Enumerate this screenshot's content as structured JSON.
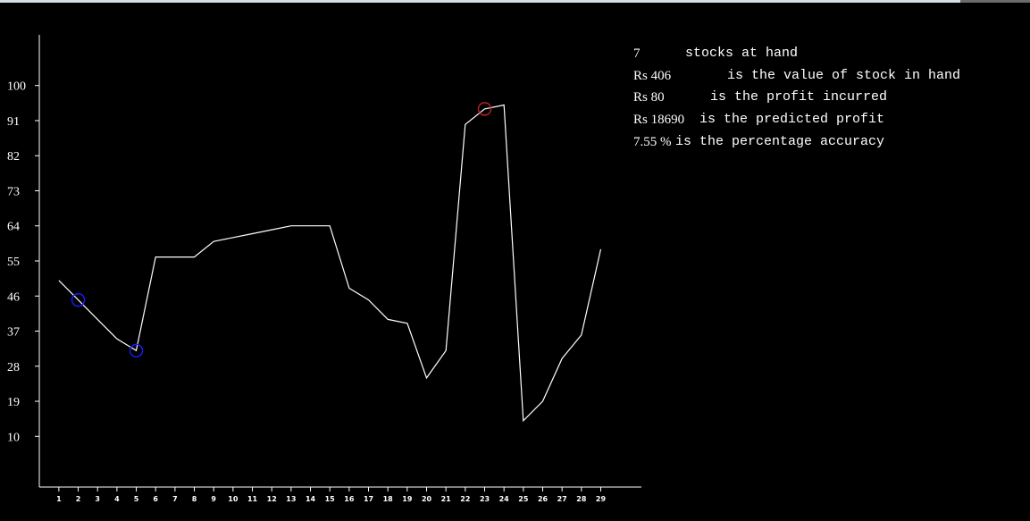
{
  "colors": {
    "background": "#000000",
    "line": "#ffffff",
    "axis": "#ffffff",
    "buy_marker": "#1a1aff",
    "sell_marker": "#c0202a"
  },
  "info": {
    "stocks_value": "7",
    "stocks_text": "stocks at hand",
    "stock_value": "Rs 406",
    "stock_text": "is the value of stock in hand",
    "profit_value": "Rs 80",
    "profit_text": "is the profit incurred",
    "predicted_value": "Rs 18690",
    "predicted_text": "is the predicted profit",
    "accuracy_value": "7.55 %",
    "accuracy_text": "is the percentage accuracy"
  },
  "chart_data": {
    "type": "line",
    "title": "",
    "xlabel": "",
    "ylabel": "",
    "x": [
      1,
      2,
      3,
      4,
      5,
      6,
      7,
      8,
      9,
      10,
      11,
      12,
      13,
      14,
      15,
      16,
      17,
      18,
      19,
      20,
      21,
      22,
      23,
      24,
      25,
      26,
      27,
      28,
      29
    ],
    "series": [
      {
        "values": [
          50,
          45,
          40,
          35,
          32,
          56,
          56,
          56,
          60,
          61,
          62,
          63,
          64,
          64,
          64,
          48,
          45,
          40,
          39,
          25,
          32,
          90,
          94,
          95,
          14,
          19,
          30,
          36,
          58
        ]
      }
    ],
    "buy_markers": [
      {
        "x": 2,
        "y": 45
      },
      {
        "x": 5,
        "y": 32
      }
    ],
    "sell_markers": [
      {
        "x": 23,
        "y": 94
      }
    ],
    "yticks": [
      10,
      19,
      28,
      37,
      46,
      55,
      64,
      73,
      82,
      91,
      100
    ],
    "xticks": [
      1,
      2,
      3,
      4,
      5,
      6,
      7,
      8,
      9,
      10,
      11,
      12,
      13,
      14,
      15,
      16,
      17,
      18,
      19,
      20,
      21,
      22,
      23,
      24,
      25,
      26,
      27,
      28,
      29
    ],
    "ylim": [
      -3,
      113
    ],
    "xlim": [
      -0.01,
      31.1
    ],
    "grid": false,
    "legend": "none"
  }
}
